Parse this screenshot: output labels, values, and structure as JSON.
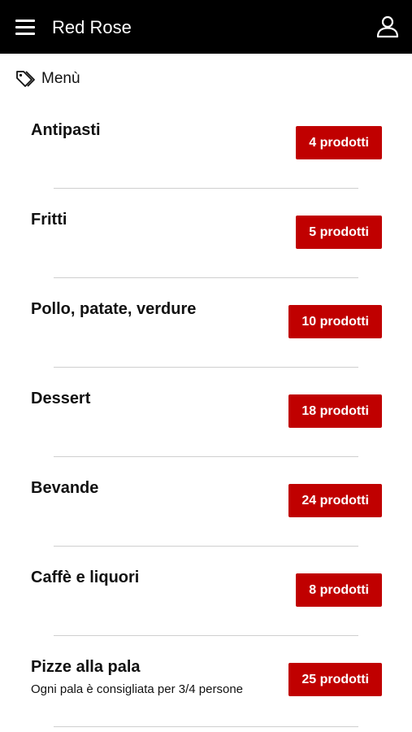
{
  "header": {
    "title": "Red Rose",
    "menu_icon": "hamburger-menu-icon",
    "user_icon": "user-account-icon",
    "background": "#000000"
  },
  "breadcrumb": {
    "icon": "tag-icon",
    "label": "Menù"
  },
  "accent_color": "#c00000",
  "categories": [
    {
      "name": "Antipasti",
      "badge": "4 prodotti",
      "description": ""
    },
    {
      "name": "Fritti",
      "badge": "5 prodotti",
      "description": ""
    },
    {
      "name": "Pollo, patate, verdure",
      "badge": "10 prodotti",
      "description": ""
    },
    {
      "name": "Dessert",
      "badge": "18 prodotti",
      "description": ""
    },
    {
      "name": "Bevande",
      "badge": "24 prodotti",
      "description": ""
    },
    {
      "name": "Caffè e liquori",
      "badge": "8 prodotti",
      "description": ""
    },
    {
      "name": "Pizze alla pala",
      "badge": "25 prodotti",
      "description": "Ogni pala è consigliata per 3/4 persone"
    }
  ]
}
